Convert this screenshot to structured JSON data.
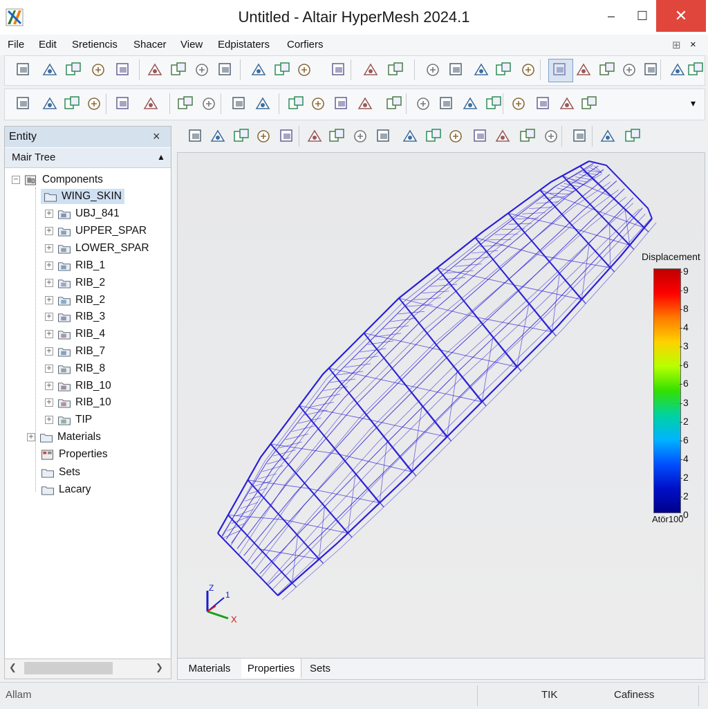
{
  "window": {
    "title": "Untitled - Altair HyperMesh 2024.1",
    "minimize_glyph": "–",
    "maximize_glyph": "☐",
    "close_glyph": "✕"
  },
  "menu": {
    "items": [
      "File",
      "Edit",
      "Sretiencis",
      "Shacer",
      "View",
      "Edpistaters",
      "Corfiers"
    ],
    "pin_glyph": "⊞",
    "close_glyph": "×"
  },
  "entity_panel": {
    "title": "Entity",
    "close_glyph": "×",
    "tree_title": "Mair Tree",
    "tree_arrow": "▲",
    "root": "Components",
    "selected": "WING_SKIN",
    "children": [
      "UBJ_841",
      "UPPER_SPAR",
      "LOWER_SPAR",
      "RIB_1",
      "RIB_2",
      "RIB_2",
      "RIB_3",
      "RIB_4",
      "RIB_7",
      "RIB_8",
      "RIB_10",
      "RIB_10",
      "TIP"
    ],
    "siblings": [
      "Materials",
      "Properties",
      "Sets",
      "Lacary"
    ]
  },
  "scrollbar": {
    "left_glyph": "❮",
    "right_glyph": "❯"
  },
  "legend": {
    "title": "Displacement",
    "ticks": [
      "9",
      "9",
      "8",
      "4",
      "3",
      "6",
      "6",
      "3",
      "2",
      "6",
      "4",
      "2",
      "2",
      "0"
    ],
    "footer": "Atör100",
    "colors": [
      "#c00000",
      "#ff0000",
      "#ff7a00",
      "#ffd200",
      "#b6ff00",
      "#34e000",
      "#00d2a0",
      "#00b4ff",
      "#0050ff",
      "#0010c8",
      "#00008a"
    ]
  },
  "axis": {
    "z": "Z",
    "one": "1",
    "x": "X"
  },
  "bottom_tabs": [
    "Materials",
    "Properties",
    "Sets"
  ],
  "status": {
    "left": "Allam",
    "mid": "TIK",
    "right": "Cafiness"
  },
  "colors": {
    "mesh": "#2a1fd6",
    "selection": "#cfe0f3",
    "close_red": "#e0463c"
  }
}
